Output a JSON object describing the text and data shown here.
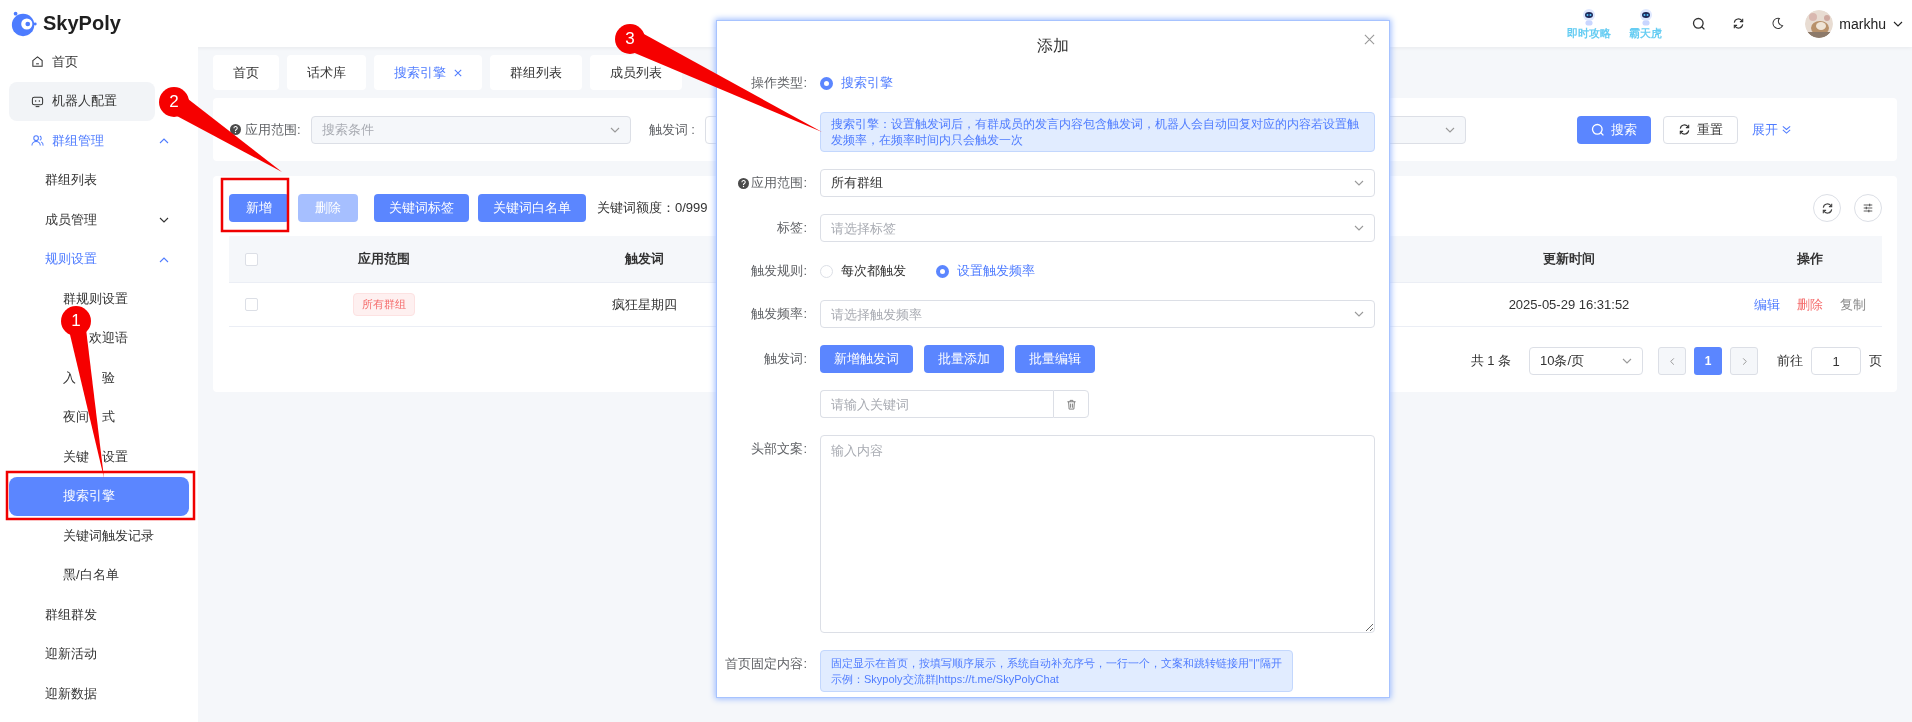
{
  "header": {
    "logo": "SkyPoly",
    "shortcuts": [
      {
        "label": "即时攻略"
      },
      {
        "label": "霸天虎"
      }
    ],
    "user": {
      "name": "markhu"
    }
  },
  "sidebar": {
    "items": [
      {
        "label": "首页",
        "kind": "home",
        "selected": false,
        "hovered": false
      },
      {
        "label": "机器人配置",
        "kind": "robot",
        "selected": false,
        "hovered": true
      },
      {
        "label": "群组管理",
        "kind": "group",
        "selected": false,
        "hovered": false,
        "expanded": true,
        "children": [
          {
            "label": "群组列表",
            "selected": false,
            "hovered": false
          },
          {
            "label": "成员管理",
            "selected": false,
            "hovered": false,
            "expanded": false
          },
          {
            "label": "规则设置",
            "selected": false,
            "hovered": false,
            "expanded": true,
            "children": [
              {
                "label": "群规则设置",
                "selected": false,
                "hovered": false
              },
              {
                "label_parts": [
                  "欢迎语"
                ],
                "selected": false,
                "hovered": false
              },
              {
                "label_parts": [
                  "入",
                  "验"
                ],
                "selected": false,
                "hovered": false
              },
              {
                "label_parts": [
                  "夜间",
                  "式"
                ],
                "selected": false,
                "hovered": false
              },
              {
                "label_parts": [
                  "关键",
                  "设置"
                ],
                "selected": false,
                "hovered": false
              },
              {
                "label": "搜索引擎",
                "selected": true,
                "hovered": false
              },
              {
                "label": "关键词触发记录",
                "selected": false,
                "hovered": false
              },
              {
                "label": "黑/白名单",
                "selected": false,
                "hovered": false
              }
            ]
          }
        ]
      },
      {
        "label": "群组群发",
        "kind": "plain",
        "selected": false,
        "hovered": false
      },
      {
        "label": "迎新活动",
        "kind": "plain",
        "selected": false,
        "hovered": false
      },
      {
        "label": "迎新数据",
        "kind": "plain",
        "selected": false,
        "hovered": false
      }
    ]
  },
  "tabs": [
    {
      "label": "首页",
      "selected": false,
      "closable": false
    },
    {
      "label": "话术库",
      "selected": false,
      "closable": false
    },
    {
      "label": "搜索引擎",
      "selected": true,
      "closable": true
    },
    {
      "label": "群组列表",
      "selected": false,
      "closable": false
    },
    {
      "label": "成员列表",
      "selected": false,
      "closable": false
    }
  ],
  "filters": {
    "fields": [
      {
        "kind": "select",
        "label": "应用范围:",
        "help": true,
        "placeholder": "搜索条件"
      },
      {
        "kind": "input",
        "label": "触发词 :"
      },
      {
        "kind": "select"
      }
    ],
    "search_button": "搜索",
    "reset_button": "重置",
    "expand_link": "展开"
  },
  "toolbar": {
    "buttons": [
      {
        "label": "新增",
        "disabled": false
      },
      {
        "label": "删除",
        "disabled": true
      },
      {
        "label": "关键词标签",
        "disabled": false
      },
      {
        "label": "关键词白名单",
        "disabled": false
      }
    ],
    "quota": {
      "label": "关键词额度：0/999",
      "level": 0
    }
  },
  "table": {
    "all_checked": false,
    "columns": [
      {
        "label": "应用范围"
      },
      {
        "label": "触发词"
      },
      {
        "label": "更新时间"
      },
      {
        "label": "操作"
      }
    ],
    "rows": [
      {
        "checked": false,
        "scope": "所有群组",
        "trigger": "疯狂星期四",
        "updated": "2025-05-29 16:31:52",
        "actions": [
          {
            "label": "编辑",
            "kind": "edit"
          },
          {
            "label": "删除",
            "kind": "danger"
          },
          {
            "label": "复制",
            "kind": "plain"
          }
        ]
      }
    ]
  },
  "pagination": {
    "total": "共 1 条",
    "page_size": "10条/页",
    "pages": [
      {
        "label": "1",
        "selected": true
      }
    ],
    "goto_label": "前往",
    "goto_value": "1",
    "page_suffix": "页"
  },
  "dialog": {
    "title": "添加",
    "fields": [
      {
        "kind": "radio",
        "label": "操作类型:",
        "options": [
          {
            "label": "搜索引擎",
            "selected": true
          }
        ]
      },
      {
        "kind": "note",
        "text": "搜索引擎：设置触发词后，有群成员的发言内容包含触发词，机器人会自动回复对应的内容若设置触发频率，在频率时间内只会触发一次"
      },
      {
        "kind": "select",
        "label": "应用范围:",
        "help": true,
        "value": "所有群组"
      },
      {
        "kind": "select",
        "label": "标签:",
        "placeholder": "请选择标签"
      },
      {
        "kind": "radio",
        "label": "触发规则:",
        "options": [
          {
            "label": "每次都触发",
            "selected": false
          },
          {
            "label": "设置触发频率",
            "selected": true
          }
        ]
      },
      {
        "kind": "select",
        "label": "触发频率:",
        "placeholder": "请选择触发频率"
      },
      {
        "kind": "buttons",
        "label": "触发词:",
        "buttons": [
          "新增触发词",
          "批量添加",
          "批量编辑"
        ]
      },
      {
        "kind": "keyword",
        "placeholder": "请输入关键词"
      },
      {
        "kind": "textarea",
        "label": "头部文案:",
        "placeholder": "输入内容"
      },
      {
        "kind": "note",
        "label": "首页固定内容:",
        "lines": [
          "固定显示在首页，按填写顺序展示，系统自动补充序号，一行一个，文案和跳转链接用\"|\"隔开",
          "示例：Skypoly交流群|https://t.me/SkyPolyChat"
        ]
      }
    ]
  },
  "annotations": [
    {
      "label": "1"
    },
    {
      "label": "2"
    },
    {
      "label": "3"
    }
  ]
}
